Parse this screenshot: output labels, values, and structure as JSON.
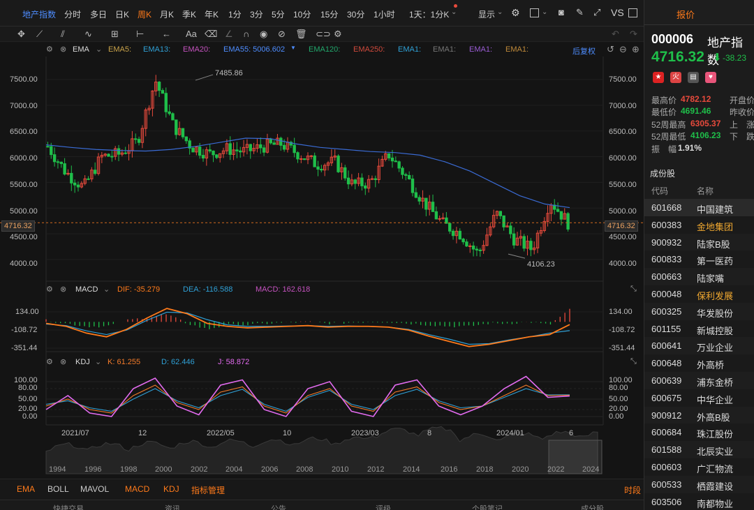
{
  "colors": {
    "up": "#e84a3c",
    "down": "#1fbf4a",
    "orange": "#ff7a1a",
    "blue": "#4e8dff",
    "ema55": "#3a6bd4",
    "kdj_k": "#f47b2a",
    "kdj_d": "#2fa0d6",
    "kdj_j": "#e36bf0"
  },
  "toolbar": {
    "symbol": "地产指数",
    "items": [
      "分时",
      "多日",
      "日K",
      "周K",
      "月K",
      "季K",
      "年K",
      "1分",
      "3分",
      "5分",
      "10分",
      "15分",
      "30分",
      "1小时",
      "1天：1分K"
    ],
    "active": "周K",
    "show": "显示",
    "vs": "VS"
  },
  "drawtools": [
    "move-icon",
    "line-icon",
    "channel-icon",
    "wave-icon",
    "measure-icon",
    "horizontal-icon",
    "arrow-icon",
    "text-icon",
    "eraser-icon",
    "magnet-icon",
    "eye-icon",
    "hide-icon",
    "trash-icon",
    "link-icon",
    "gear-icon"
  ],
  "main": {
    "legend_title": "EMA",
    "ema": [
      "EMA5:",
      "EMA13:",
      "EMA20:",
      "EMA55: 5006.602",
      "EMA120:",
      "EMA250:",
      "EMA1:",
      "EMA1:",
      "EMA1:",
      "EMA1:"
    ],
    "adjust": "后复权",
    "yticks": [
      "7500.00",
      "7000.00",
      "6500.00",
      "6000.00",
      "5500.00",
      "5000.00",
      "4500.00",
      "4000.00"
    ],
    "current": "4716.32",
    "high_label": "7485.86",
    "low_label": "4106.23"
  },
  "macd": {
    "title": "MACD",
    "dif": "DIF: -35.279",
    "dea": "DEA: -116.588",
    "macd": "MACD: 162.618",
    "yticks": [
      "134.00",
      "-108.72",
      "-351.44"
    ]
  },
  "kdj": {
    "title": "KDJ",
    "k": "K: 61.255",
    "d": "D: 62.446",
    "j": "J: 58.872",
    "yticks": [
      "100.00",
      "80.00",
      "50.00",
      "20.00",
      "0.00"
    ]
  },
  "xaxis": [
    "2021/07",
    "12",
    "2022/05",
    "10",
    "2023/03",
    "8",
    "2024/01",
    "6"
  ],
  "overview": [
    "1994",
    "1996",
    "1998",
    "2000",
    "2002",
    "2004",
    "2006",
    "2008",
    "2010",
    "2012",
    "2014",
    "2016",
    "2018",
    "2020",
    "2022",
    "2024"
  ],
  "indicators": [
    "EMA",
    "BOLL",
    "MAVOL",
    "MACD",
    "KDJ",
    "指标管理"
  ],
  "period": "时段",
  "cut_tabs": [
    "快捷交易",
    "资讯",
    "公告",
    "评级",
    "个股笔记",
    "成分股"
  ],
  "side": {
    "tab": "报价",
    "code": "000006",
    "name": "地产指数",
    "price": "4716.32",
    "arrow": "⬇",
    "change": "-38.23",
    "stats": [
      {
        "label": "最高价",
        "value": "4782.12",
        "right": "开盘价"
      },
      {
        "label": "最低价",
        "value": "4691.46",
        "right": "昨收价"
      },
      {
        "label": "52周最高",
        "value": "6305.37",
        "right": "上　涨"
      },
      {
        "label": "52周最低",
        "value": "4106.23",
        "right": "下　跌"
      },
      {
        "label": "振　幅",
        "value": "1.91%",
        "right": ""
      }
    ],
    "section": "成份股",
    "head_code": "代码",
    "head_name": "名称",
    "constituents": [
      {
        "code": "601668",
        "name": "中国建筑"
      },
      {
        "code": "600383",
        "name": "金地集团"
      },
      {
        "code": "900932",
        "name": "陆家B股"
      },
      {
        "code": "600833",
        "name": "第一医药"
      },
      {
        "code": "600663",
        "name": "陆家嘴"
      },
      {
        "code": "600048",
        "name": "保利发展"
      },
      {
        "code": "600325",
        "name": "华发股份"
      },
      {
        "code": "601155",
        "name": "新城控股"
      },
      {
        "code": "600641",
        "name": "万业企业"
      },
      {
        "code": "600648",
        "name": "外高桥"
      },
      {
        "code": "600639",
        "name": "浦东金桥"
      },
      {
        "code": "600675",
        "name": "中华企业"
      },
      {
        "code": "900912",
        "name": "外高B股"
      },
      {
        "code": "600684",
        "name": "珠江股份"
      },
      {
        "code": "601588",
        "name": "北辰实业"
      },
      {
        "code": "600603",
        "name": "广汇物流"
      },
      {
        "code": "600533",
        "name": "栖霞建设"
      },
      {
        "code": "603506",
        "name": "南都物业"
      }
    ]
  },
  "chart_data": [
    {
      "type": "candlestick",
      "series": [
        {
          "name": "EMA55",
          "values": [
            6230,
            6180,
            6140,
            6120,
            6110,
            6140,
            6200,
            6280,
            6360,
            6350,
            6250,
            6180,
            6140,
            6100,
            6080,
            6030,
            5900,
            5720,
            5480,
            5240,
            5080,
            5010
          ]
        }
      ],
      "x": [
        "2021/07",
        "12",
        "2022/05",
        "10",
        "2023/03",
        "8",
        "2024/01",
        "6"
      ],
      "close_series": [
        6200,
        5700,
        5400,
        6000,
        6050,
        6300,
        7485.86,
        6600,
        6200,
        6050,
        6150,
        6100,
        6200,
        6250,
        6050,
        5850,
        5900,
        5450,
        5500,
        6050,
        5600,
        5100,
        4700,
        4500,
        4106.23,
        4900,
        4400,
        4200,
        5150,
        4716.32
      ],
      "ylim": [
        3900,
        7700
      ],
      "high": 7485.86,
      "low": 4106.23
    },
    {
      "type": "line",
      "title": "MACD",
      "series": [
        {
          "name": "DIF",
          "values": [
            -20,
            -60,
            -150,
            -200,
            -100,
            50,
            180,
            110,
            -20,
            -60,
            -80,
            -70,
            -60,
            -50,
            -70,
            -60,
            -60,
            -70,
            -110,
            -190,
            -260,
            -330,
            -300,
            -250,
            -200,
            -170,
            -35.279
          ]
        },
        {
          "name": "DEA",
          "values": [
            -30,
            -50,
            -120,
            -170,
            -110,
            20,
            130,
            120,
            30,
            -40,
            -60,
            -60,
            -55,
            -50,
            -60,
            -55,
            -60,
            -70,
            -100,
            -170,
            -230,
            -300,
            -290,
            -240,
            -200,
            -150,
            -116.588
          ]
        }
      ],
      "ylim": [
        -380,
        180
      ]
    },
    {
      "type": "line",
      "title": "KDJ",
      "series": [
        {
          "name": "K",
          "values": [
            30,
            50,
            20,
            10,
            60,
            90,
            40,
            20,
            70,
            85,
            30,
            10,
            60,
            80,
            30,
            15,
            70,
            85,
            40,
            20,
            30,
            60,
            90,
            60,
            61.255
          ]
        },
        {
          "name": "D",
          "values": [
            35,
            45,
            25,
            15,
            50,
            80,
            45,
            25,
            60,
            78,
            35,
            15,
            55,
            75,
            35,
            20,
            60,
            78,
            45,
            25,
            30,
            55,
            80,
            62,
            62.446
          ]
        },
        {
          "name": "J",
          "values": [
            20,
            60,
            10,
            0,
            80,
            110,
            30,
            5,
            90,
            105,
            20,
            0,
            80,
            100,
            15,
            0,
            90,
            105,
            30,
            5,
            30,
            80,
            115,
            55,
            58.872
          ]
        }
      ],
      "ylim": [
        -5,
        115
      ]
    }
  ]
}
